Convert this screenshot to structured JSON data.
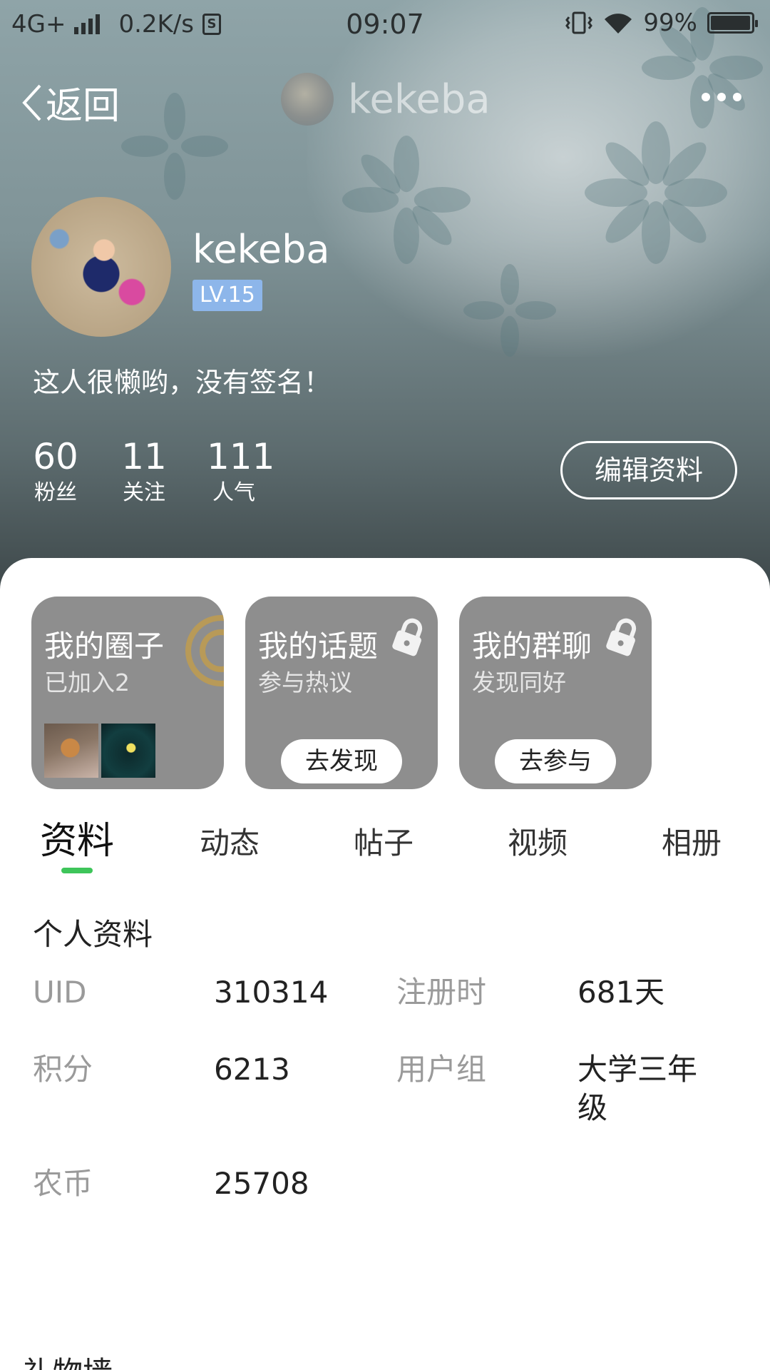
{
  "status_bar": {
    "network": "4G+",
    "speed": "0.2K/s",
    "time": "09:07",
    "battery": "99%",
    "battery_level": 0.99
  },
  "nav": {
    "back_label": "返回",
    "title": "kekeba"
  },
  "profile": {
    "username": "kekeba",
    "level": "LV.15",
    "signature": "这人很懒哟，没有签名！",
    "stats": [
      {
        "value": "60",
        "label": "粉丝"
      },
      {
        "value": "11",
        "label": "关注"
      },
      {
        "value": "111",
        "label": "人气"
      }
    ],
    "edit_label": "编辑资料"
  },
  "cards": [
    {
      "title": "我的圈子",
      "subtitle": "已加入2"
    },
    {
      "title": "我的话题",
      "subtitle": "参与热议",
      "button": "去发现"
    },
    {
      "title": "我的群聊",
      "subtitle": "发现同好",
      "button": "去参与"
    }
  ],
  "tabs": [
    "资料",
    "动态",
    "帖子",
    "视频",
    "相册"
  ],
  "info": {
    "section_title": "个人资料",
    "rows": [
      {
        "k1": "UID",
        "v1": "310314",
        "k2": "注册时",
        "v2": "681天"
      },
      {
        "k1": "积分",
        "v1": "6213",
        "k2": "用户组",
        "v2": "大学三年级"
      },
      {
        "k1": "农币",
        "v1": "25708",
        "k2": "",
        "v2": ""
      }
    ]
  },
  "gift_title": "礼物墙",
  "colors": {
    "tab_indicator": "#3ec55a",
    "level_badge": "#8db6ea",
    "card_bg": "#8e8e8e"
  }
}
